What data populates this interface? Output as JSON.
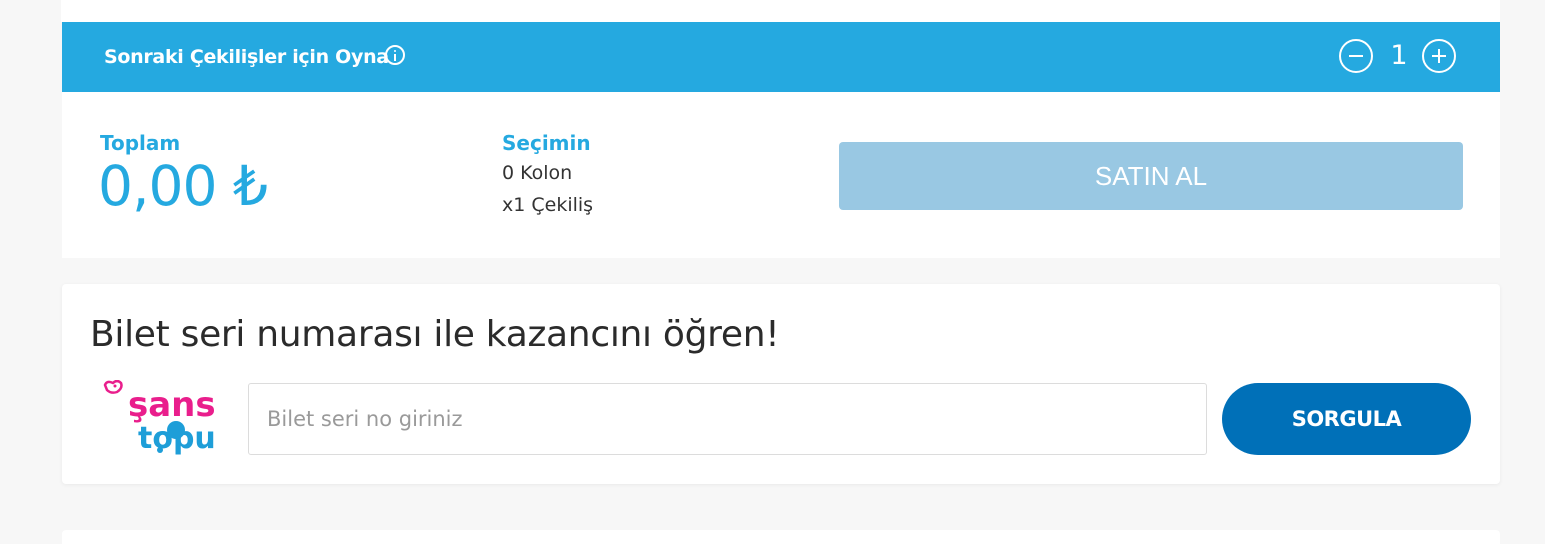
{
  "draws_bar": {
    "title": "Sonraki Çekilişler için Oyna",
    "draw_count": "1",
    "bg_color": "#25a9e0"
  },
  "summary": {
    "total_label": "Toplam",
    "total_value": "0,00 ₺",
    "selection_label": "Seçimin",
    "columns_text": "0 Kolon",
    "draws_text": "x1 Çekiliş",
    "buy_label": "SATIN AL",
    "buy_color": "#99c8e3"
  },
  "ticket_query": {
    "heading": "Bilet seri numarası ile kazancını öğren!",
    "logo_text_top": "şans",
    "logo_text_bottom": "topu",
    "input_placeholder": "Bilet seri no giriniz",
    "input_value": "",
    "query_label": "SORGULA",
    "query_color": "#0070b8"
  },
  "icons": [
    "info-icon",
    "minus-icon",
    "plus-icon",
    "sans-topu-logo"
  ]
}
